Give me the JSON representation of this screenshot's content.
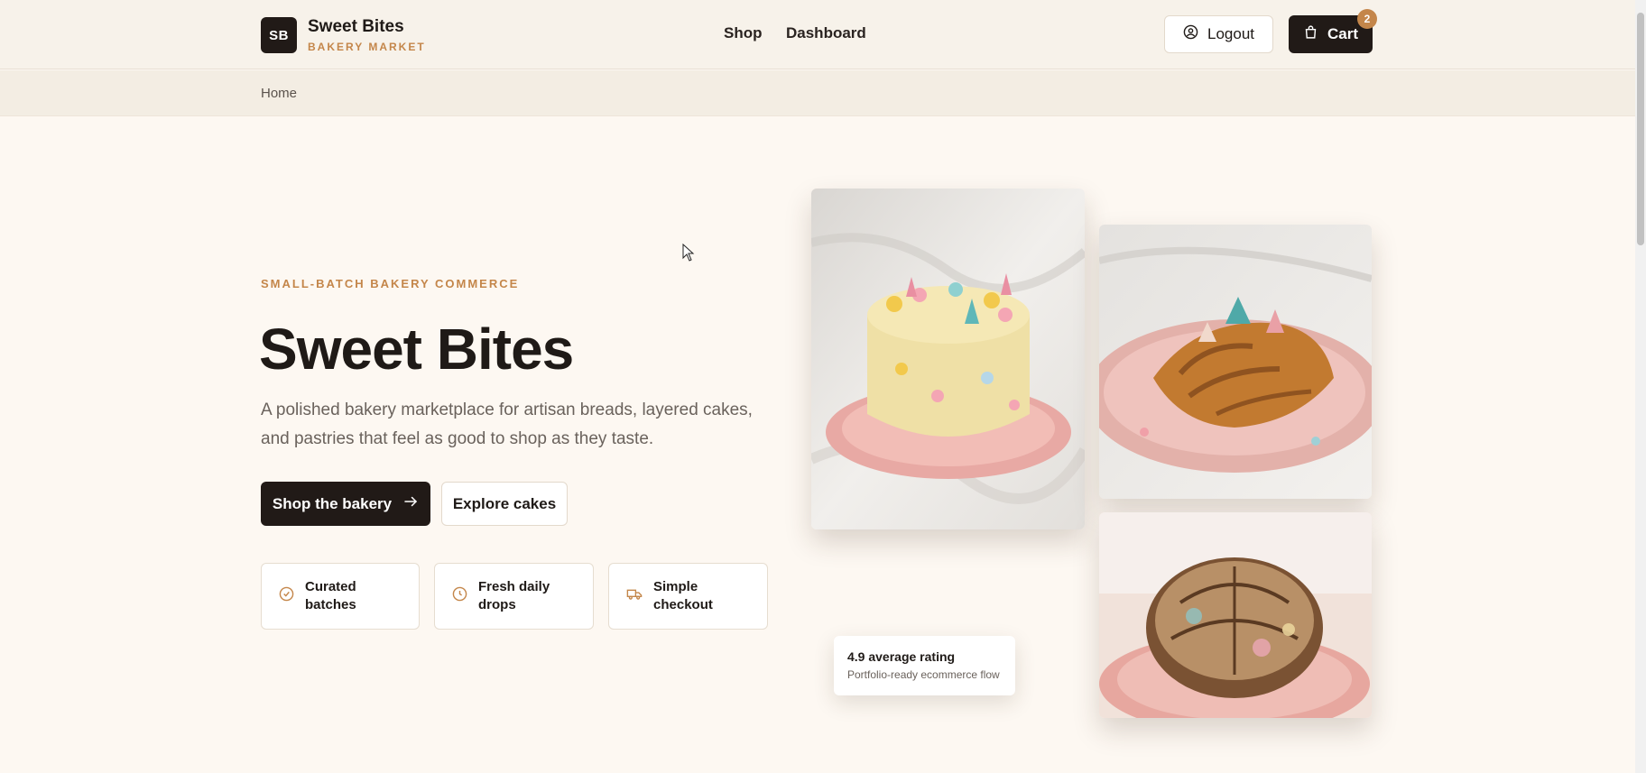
{
  "header": {
    "logo_initials": "SB",
    "brand_name": "Sweet Bites",
    "brand_subtitle": "BAKERY MARKET",
    "nav": [
      {
        "label": "Shop"
      },
      {
        "label": "Dashboard"
      }
    ],
    "logout_label": "Logout",
    "cart_label": "Cart",
    "cart_count": "2"
  },
  "breadcrumb": {
    "label": "Home"
  },
  "hero": {
    "eyebrow": "SMALL-BATCH BAKERY COMMERCE",
    "title": "Sweet Bites",
    "description": "A polished bakery marketplace for artisan breads, layered cakes, and pastries that feel as good to shop as they taste.",
    "primary_cta": "Shop the bakery",
    "secondary_cta": "Explore cakes",
    "features": [
      {
        "label": "Curated batches",
        "icon": "check-circle-icon"
      },
      {
        "label": "Fresh daily drops",
        "icon": "clock-icon"
      },
      {
        "label": "Simple checkout",
        "icon": "truck-icon"
      }
    ]
  },
  "rating_card": {
    "title": "4.9 average rating",
    "subtitle": "Portfolio-ready ecommerce flow"
  },
  "colors": {
    "accent": "#c4864a",
    "dark": "#211a17",
    "background": "#fdf8f2"
  }
}
